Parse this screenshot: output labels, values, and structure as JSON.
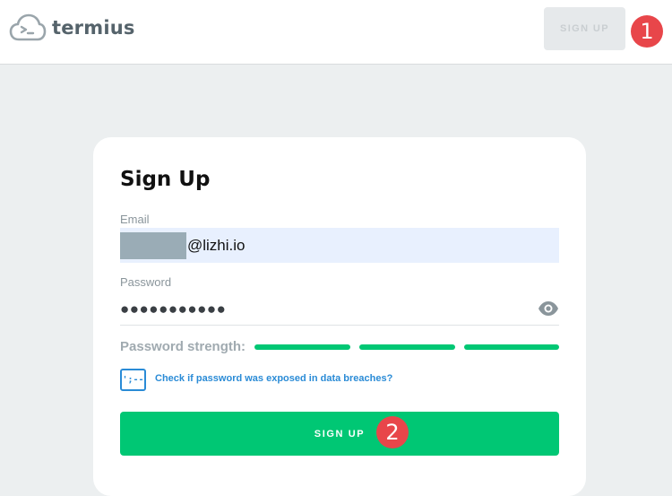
{
  "header": {
    "brand": "termius",
    "signup_label": "SIGN UP",
    "marker": "1"
  },
  "form": {
    "title": "Sign Up",
    "email_label": "Email",
    "email_value": "@lizhi.io",
    "password_label": "Password",
    "password_value": "●●●●●●●●●●●",
    "strength_label": "Password strength:",
    "strength_level": "3/3",
    "breach_icon_text": "';--",
    "breach_link": "Check if password was exposed in data breaches?",
    "submit_label": "SIGN UP",
    "marker": "2"
  },
  "colors": {
    "accent": "#00c774",
    "link": "#2a8bd6",
    "marker": "#e8464a"
  }
}
